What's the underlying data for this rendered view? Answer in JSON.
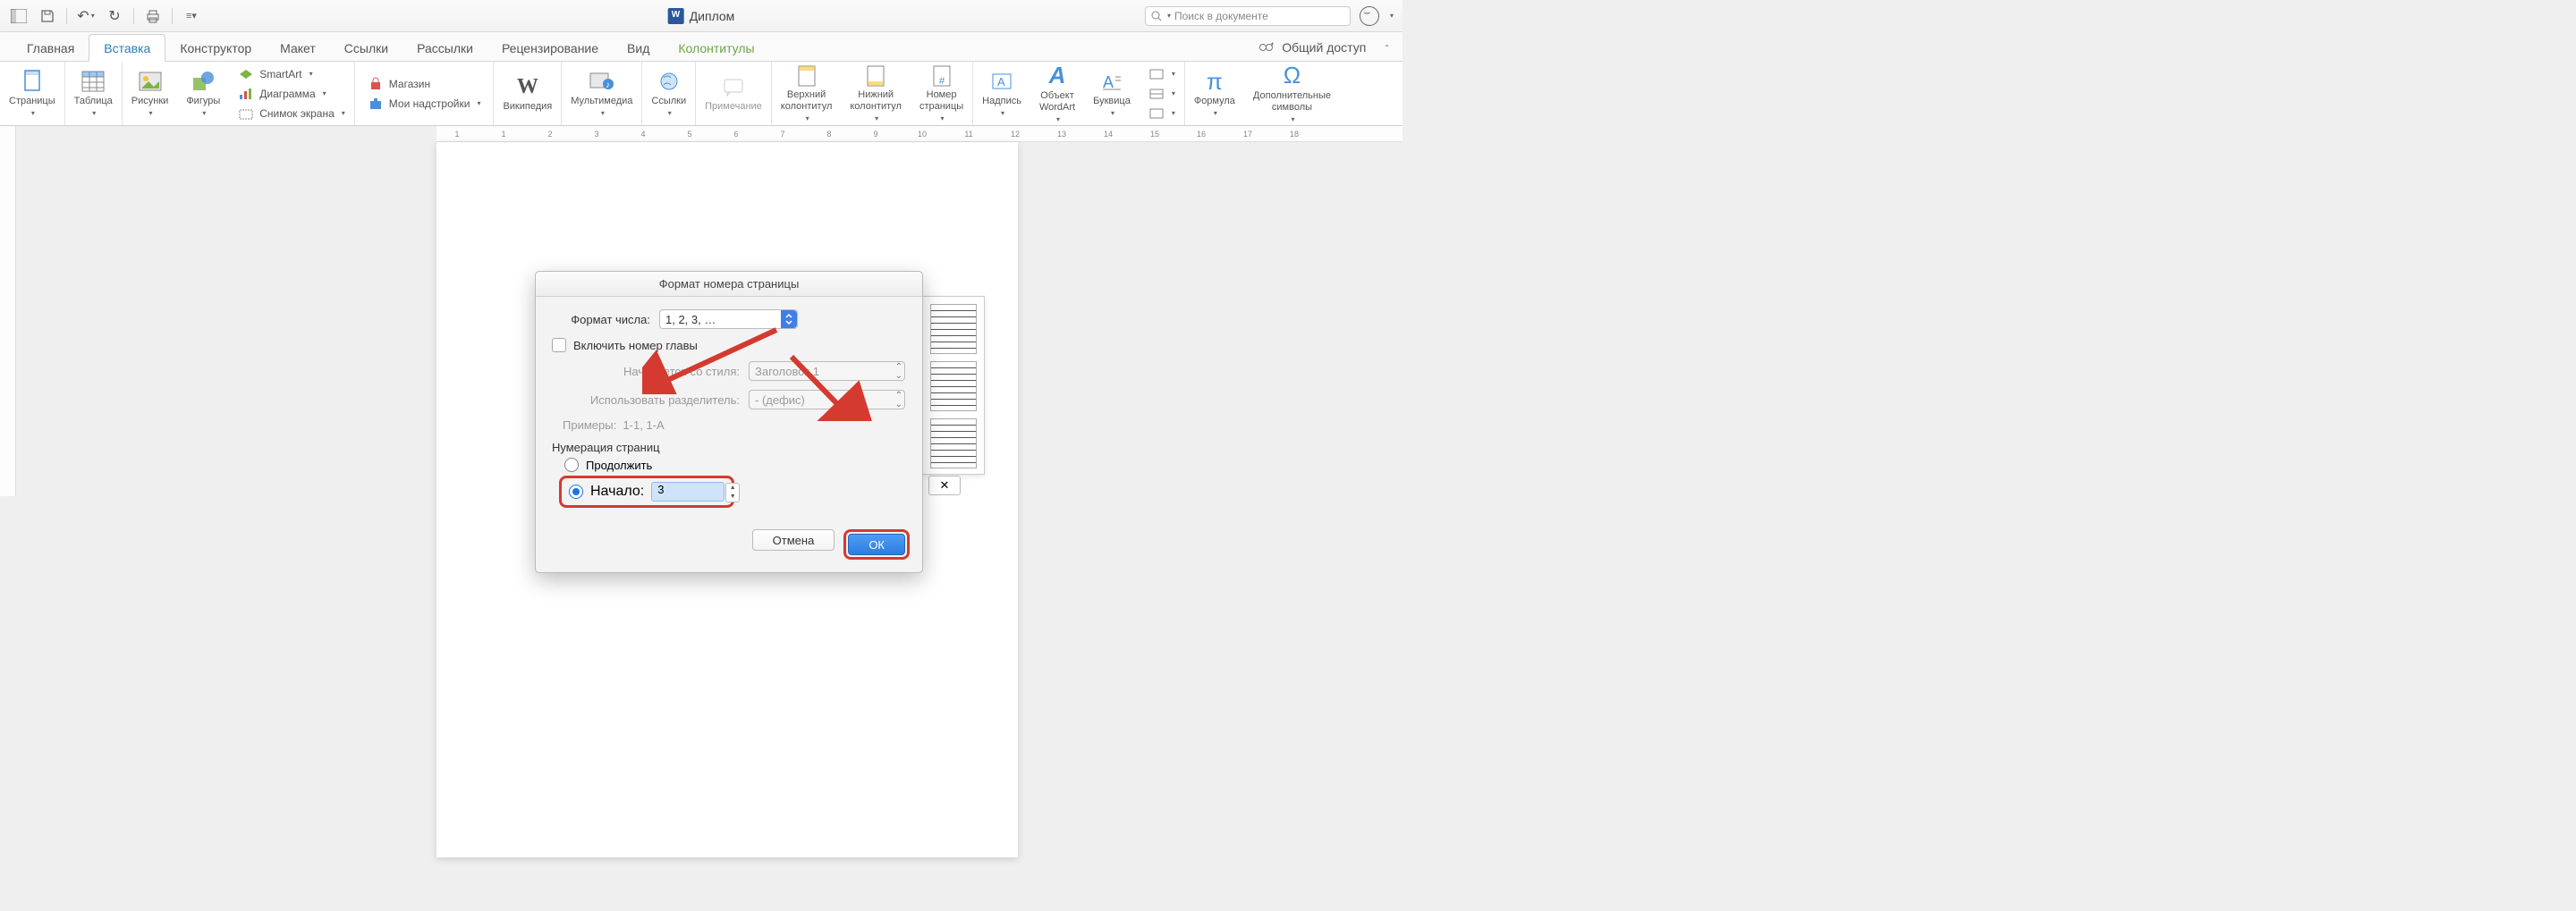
{
  "titlebar": {
    "doc_title": "Диплом",
    "search_placeholder": "Поиск в документе"
  },
  "tabs": {
    "home": "Главная",
    "insert": "Вставка",
    "design": "Конструктор",
    "layout": "Макет",
    "references": "Ссылки",
    "mailings": "Рассылки",
    "review": "Рецензирование",
    "view": "Вид",
    "headerfooter": "Колонтитулы",
    "share": "Общий доступ"
  },
  "ribbon": {
    "pages": "Страницы",
    "table": "Таблица",
    "pictures": "Рисунки",
    "shapes": "Фигуры",
    "smartart": "SmartArt",
    "chart": "Диаграмма",
    "screenshot": "Снимок экрана",
    "store": "Магазин",
    "addins": "Мои надстройки",
    "wikipedia": "Википедия",
    "media": "Мультимедиа",
    "links": "Ссылки",
    "comment": "Примечание",
    "header": "Верхний\nколонтитул",
    "footer": "Нижний\nколонтитул",
    "pagenum": "Номер\nстраницы",
    "textbox": "Надпись",
    "wordart": "Объект\nWordArt",
    "dropcap": "Буквица",
    "equation": "Формула",
    "symbol": "Дополнительные\nсимволы"
  },
  "ruler_marks": [
    "1",
    "1",
    "2",
    "3",
    "4",
    "5",
    "6",
    "7",
    "8",
    "9",
    "10",
    "11",
    "12",
    "13",
    "14",
    "15",
    "16",
    "17",
    "18"
  ],
  "dialog": {
    "title": "Формат номера страницы",
    "number_format_label": "Формат числа:",
    "number_format_value": "1, 2, 3, …",
    "include_chapter": "Включить номер главы",
    "start_style_label": "Начинается со стиля:",
    "start_style_value": "Заголовок 1",
    "separator_label": "Использовать разделитель:",
    "separator_value": "-    (дефис)",
    "examples_label": "Примеры:",
    "examples_value": "1-1, 1-A",
    "numbering_header": "Нумерация страниц",
    "continue": "Продолжить",
    "start_at": "Начало:",
    "start_value": "3",
    "cancel": "Отмена",
    "ok": "ОК"
  }
}
